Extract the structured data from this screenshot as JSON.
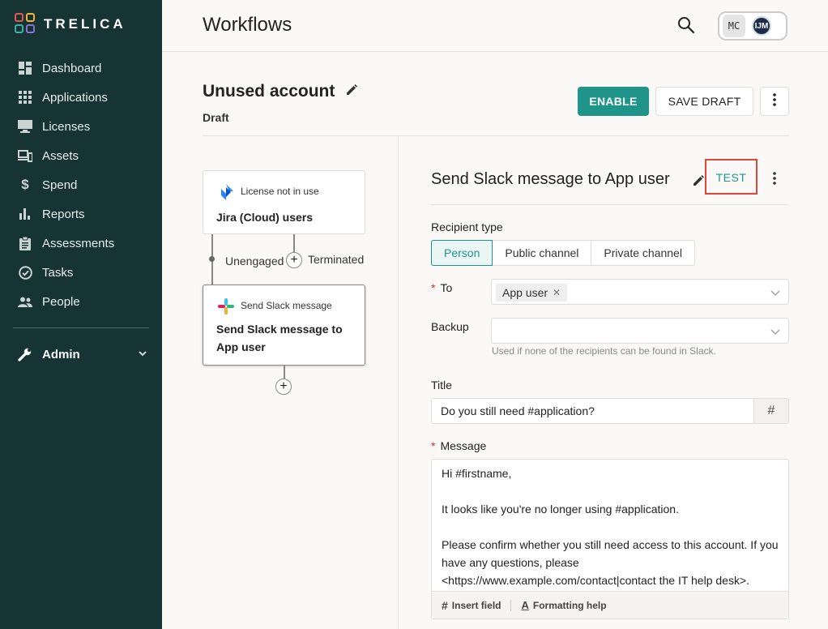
{
  "app": {
    "brand": "TRELICA"
  },
  "sidebar": {
    "items": [
      {
        "label": "Dashboard",
        "icon": "dashboard-icon"
      },
      {
        "label": "Applications",
        "icon": "grid-icon"
      },
      {
        "label": "Licenses",
        "icon": "license-icon"
      },
      {
        "label": "Assets",
        "icon": "devices-icon"
      },
      {
        "label": "Spend",
        "icon": "dollar-icon"
      },
      {
        "label": "Reports",
        "icon": "bar-chart-icon"
      },
      {
        "label": "Assessments",
        "icon": "clipboard-icon"
      },
      {
        "label": "Tasks",
        "icon": "check-circle-icon"
      },
      {
        "label": "People",
        "icon": "people-icon"
      }
    ],
    "admin": {
      "label": "Admin",
      "icon": "wrench-icon"
    }
  },
  "header": {
    "title": "Workflows",
    "avatars": [
      "MC",
      "IJM"
    ]
  },
  "workflow": {
    "name": "Unused account",
    "status": "Draft",
    "enable_label": "ENABLE",
    "save_draft_label": "SAVE DRAFT"
  },
  "flow": {
    "trigger": {
      "type": "License not in use",
      "label": "Jira (Cloud) users"
    },
    "branches": {
      "left": "Unengaged",
      "right": "Terminated"
    },
    "action": {
      "type": "Send Slack message",
      "label": "Send Slack message to App user"
    }
  },
  "step": {
    "title": "Send Slack message to App user",
    "test_label": "TEST",
    "recipient_type": {
      "label": "Recipient type",
      "options": [
        "Person",
        "Public channel",
        "Private channel"
      ],
      "selected": "Person"
    },
    "to": {
      "label": "To",
      "value": "App user"
    },
    "backup": {
      "label": "Backup",
      "value": "",
      "hint": "Used if none of the recipients can be found in Slack."
    },
    "title_field": {
      "label": "Title",
      "value": "Do you still need #application?"
    },
    "message": {
      "label": "Message",
      "paragraphs": [
        "Hi #firstname,",
        "It looks like you're no longer using #application.",
        "Please confirm whether you still need access to this account. If you have any questions, please <https://www.example.com/contact|contact the IT help desk>."
      ],
      "insert_field_label": "Insert field",
      "formatting_help_label": "Formatting help"
    }
  },
  "colors": {
    "sidebar": "#153433",
    "accent": "#1f9589",
    "highlight": "#e0453c",
    "required": "#c0392b"
  }
}
